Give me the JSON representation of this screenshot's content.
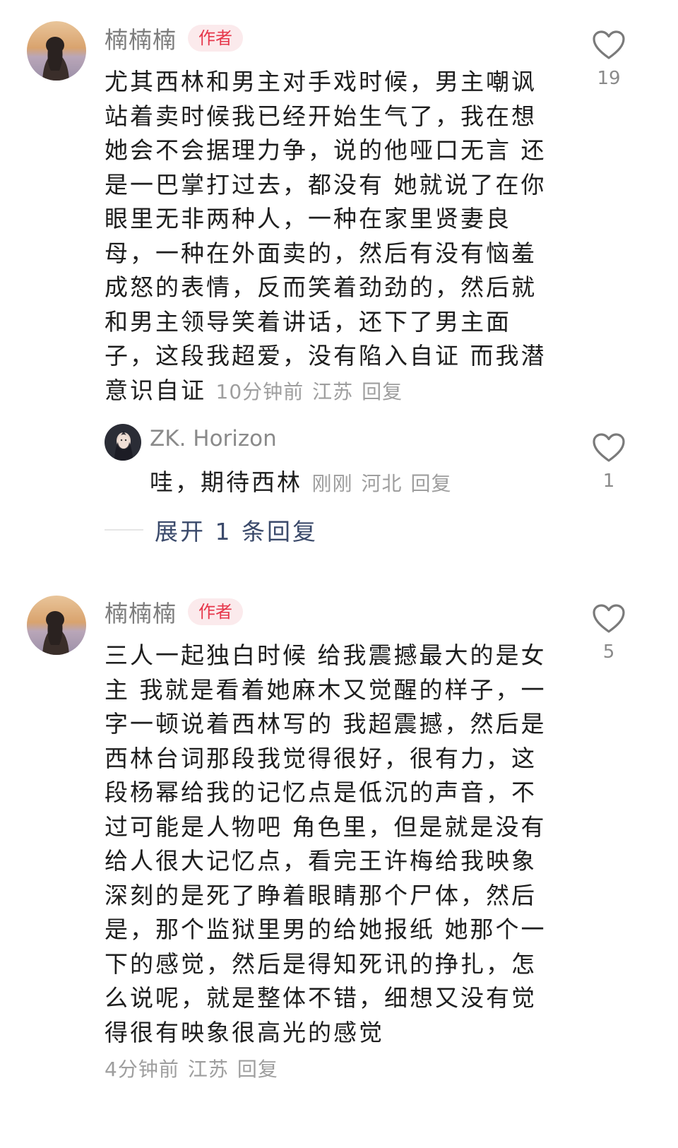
{
  "comments": [
    {
      "username": "楠楠楠",
      "tag": "作者",
      "lines": [
        "尤其西林和男主对手戏时候，男主嘲讽",
        "站着卖时候我已经开始生气了，我在想",
        "她会不会据理力争，说的他哑口无言 还",
        "是一巴掌打过去，都没有 她就说了在你",
        "眼里无非两种人，一种在家里贤妻良",
        "母，一种在外面卖的，然后有没有恼羞",
        "成怒的表情，反而笑着劲劲的，然后就",
        "和男主领导笑着讲话，还下了男主面",
        "子，这段我超爱，没有陷入自证 而我潜",
        "意识自证"
      ],
      "time": "10分钟前",
      "location": "江苏",
      "reply_label": "回复",
      "likes": "19",
      "like_icon": "heart-outline-icon",
      "replies": [
        {
          "username": "ZK. Horizon",
          "text": "哇，期待西林",
          "time": "刚刚",
          "location": "河北",
          "reply_label": "回复",
          "likes": "1"
        }
      ],
      "expand_label": "展开 1 条回复"
    },
    {
      "username": "楠楠楠",
      "tag": "作者",
      "lines": [
        "三人一起独白时候 给我震撼最大的是女",
        "主 我就是看着她麻木又觉醒的样子，一",
        "字一顿说着西林写的 我超震撼，然后是",
        "西林台词那段我觉得很好，很有力，这",
        "段杨幂给我的记忆点是低沉的声音，不",
        "过可能是人物吧 角色里，但是就是没有",
        "给人很大记忆点，看完王许梅给我映象",
        "深刻的是死了睁着眼睛那个尸体，然后",
        "是，那个监狱里男的给她报纸 她那个一",
        "下的感觉，然后是得知死讯的挣扎，怎",
        "么说呢，就是整体不错，细想又没有觉",
        "得很有映象很高光的感觉"
      ],
      "time": "4分钟前",
      "location": "江苏",
      "reply_label": "回复",
      "likes": "5",
      "like_icon": "heart-outline-icon"
    }
  ],
  "colors": {
    "tag_bg": "#fbeaec",
    "tag_text": "#e6374b",
    "meta_text": "#9e9e9e",
    "body_text": "#1e1e1e",
    "expand_text": "#3b4a6b"
  }
}
